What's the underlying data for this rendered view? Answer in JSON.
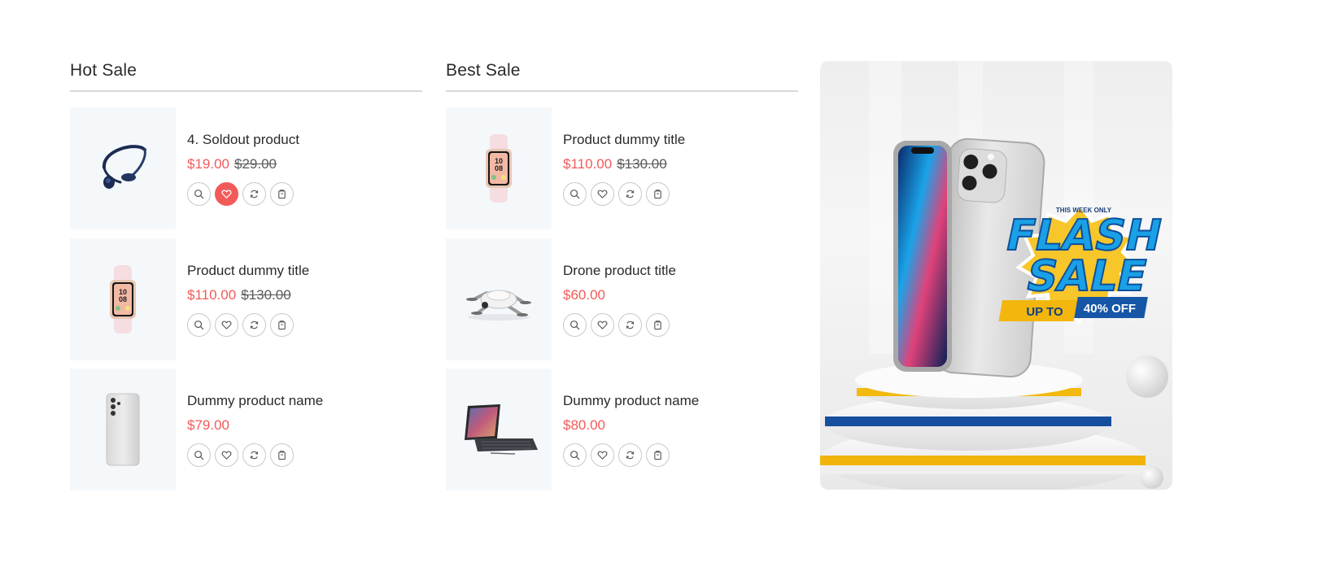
{
  "hot_sale": {
    "title": "Hot Sale",
    "items": [
      {
        "title": "4. Soldout product",
        "price": "$19.00",
        "old_price": "$29.00",
        "image": "headphones-icon",
        "wishlisted": true
      },
      {
        "title": "Product dummy title",
        "price": "$110.00",
        "old_price": "$130.00",
        "image": "smartwatch-icon",
        "wishlisted": false
      },
      {
        "title": "Dummy product name",
        "price": "$79.00",
        "old_price": "",
        "image": "smartphone-icon",
        "wishlisted": false
      }
    ]
  },
  "best_sale": {
    "title": "Best Sale",
    "items": [
      {
        "title": "Product dummy title",
        "price": "$110.00",
        "old_price": "$130.00",
        "image": "smartwatch-icon",
        "wishlisted": false
      },
      {
        "title": "Drone product title",
        "price": "$60.00",
        "old_price": "",
        "image": "drone-icon",
        "wishlisted": false
      },
      {
        "title": "Dummy product name",
        "price": "$80.00",
        "old_price": "",
        "image": "tablet-icon",
        "wishlisted": false
      }
    ]
  },
  "actions": [
    "search-icon",
    "heart-icon",
    "compare-icon",
    "cart-icon"
  ],
  "banner": {
    "kicker": "THIS WEEK ONLY",
    "headline_1": "FLASH",
    "headline_2": "SALE",
    "up_to": "UP TO",
    "discount": "40% OFF"
  },
  "colors": {
    "price": "#f25a5a",
    "accent_blue": "#1f7fd0",
    "accent_yellow": "#f2b90f",
    "thumb_bg": "#f5f8fb"
  }
}
